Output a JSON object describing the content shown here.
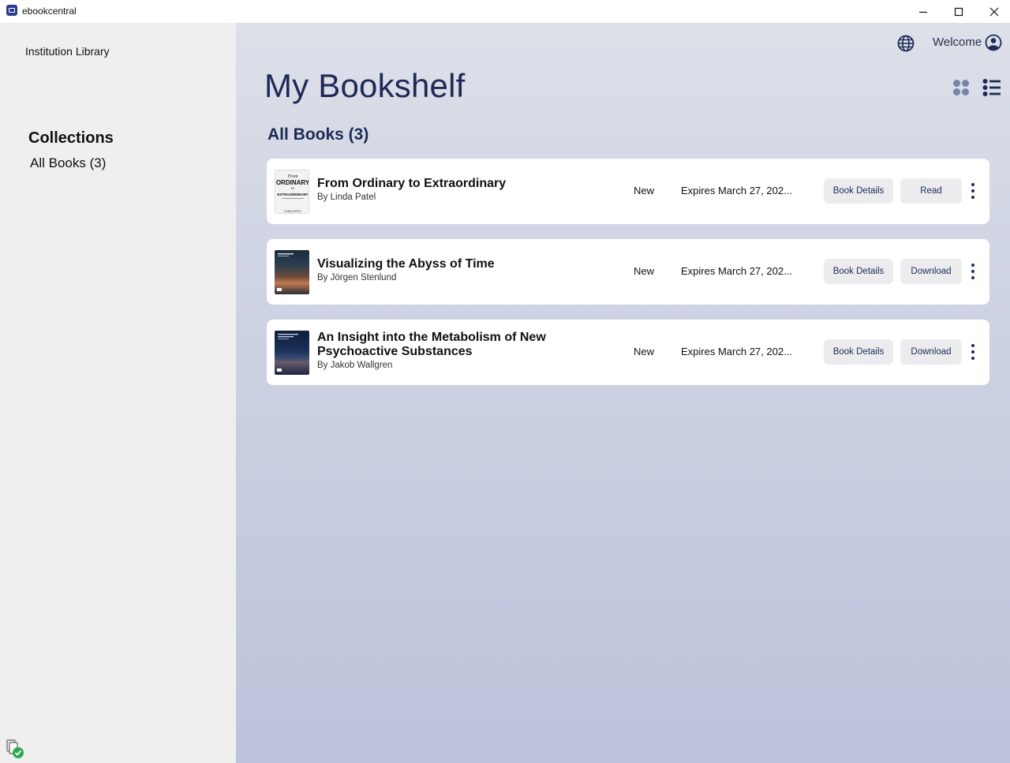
{
  "window": {
    "title": "ebookcentral",
    "minimize_glyph": "—",
    "close_glyph": "✕"
  },
  "sidebar": {
    "library_name": "Institution Library",
    "collections_heading": "Collections",
    "collections": [
      {
        "label": "All Books (3)"
      }
    ]
  },
  "header": {
    "welcome": "Welcome",
    "page_title": "My Bookshelf"
  },
  "main": {
    "section_title": "All Books (3)",
    "books": [
      {
        "title": "From Ordinary to Extraordinary",
        "author": "By Linda Patel",
        "status": "New",
        "expires_prefix": "Expires ",
        "expires_date": "March 27, 202...",
        "details_label": "Book Details",
        "action_label": "Read",
        "cover_text": [
          "From",
          "ORDINARY",
          "to",
          "EXTRAORDINARY",
          "LINDA PATEL"
        ]
      },
      {
        "title": "Visualizing the Abyss of Time",
        "author": "By Jörgen Stenlund",
        "status": "New",
        "expires_prefix": "Expires ",
        "expires_date": "March 27, 202...",
        "details_label": "Book Details",
        "action_label": "Download"
      },
      {
        "title": "An Insight into the Metabolism of New Psychoactive Substances",
        "author": "By Jakob Wallgren",
        "status": "New",
        "expires_prefix": "Expires ",
        "expires_date": "March 27, 202...",
        "details_label": "Book Details",
        "action_label": "Download"
      }
    ]
  },
  "colors": {
    "accent": "#1e2a55",
    "sidebar_bg": "#efefef",
    "main_bg_top": "#dde0e9",
    "main_bg_bottom": "#bec3dc",
    "sync_ok": "#2fa84f"
  },
  "icons": [
    "app-icon",
    "minimize-icon",
    "maximize-icon",
    "close-icon",
    "globe-icon",
    "user-icon",
    "grid-view-icon",
    "list-view-icon",
    "more-options-icon",
    "sync-status-icon"
  ]
}
